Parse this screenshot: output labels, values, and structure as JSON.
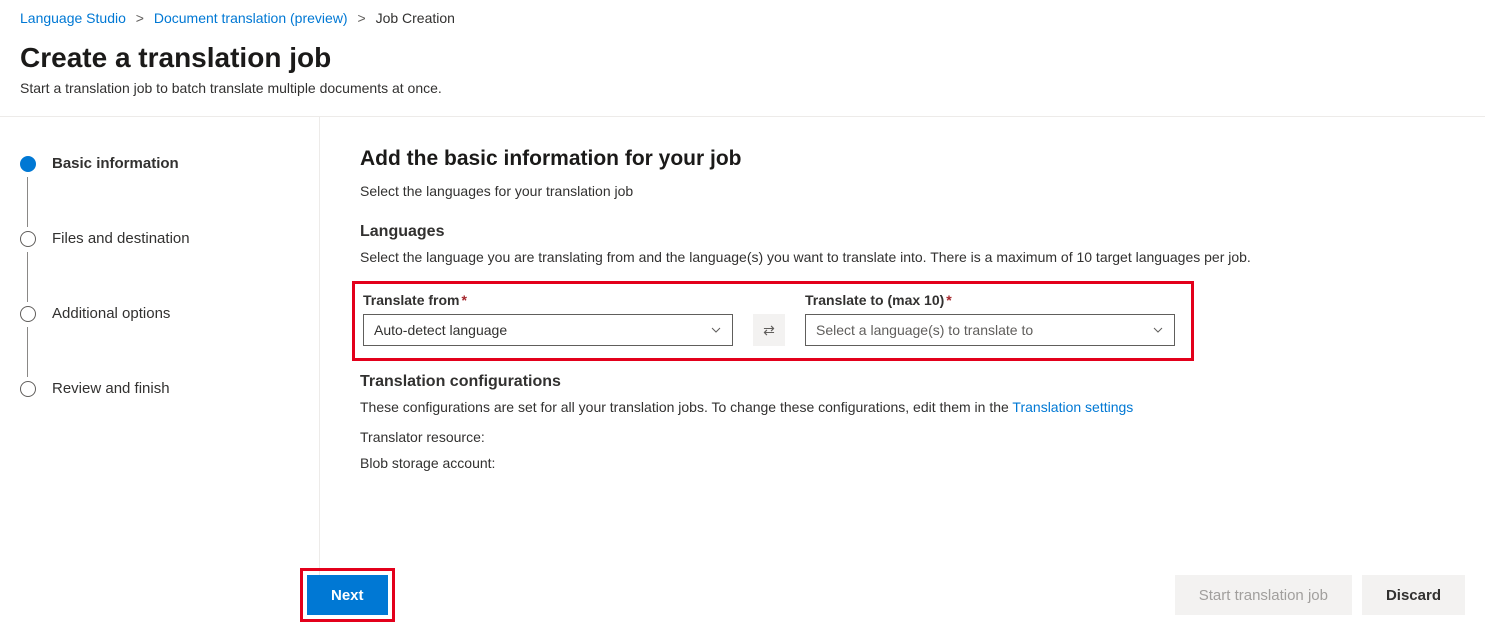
{
  "breadcrumb": {
    "items": [
      {
        "label": "Language Studio",
        "link": true
      },
      {
        "label": "Document translation (preview)",
        "link": true
      },
      {
        "label": "Job Creation",
        "link": false
      }
    ]
  },
  "header": {
    "title": "Create a translation job",
    "subtitle": "Start a translation job to batch translate multiple documents at once."
  },
  "steps": [
    {
      "label": "Basic information",
      "active": true
    },
    {
      "label": "Files and destination",
      "active": false
    },
    {
      "label": "Additional options",
      "active": false
    },
    {
      "label": "Review and finish",
      "active": false
    }
  ],
  "main": {
    "title": "Add the basic information for your job",
    "subtitle": "Select the languages for your translation job",
    "languages": {
      "heading": "Languages",
      "description": "Select the language you are translating from and the language(s) you want to translate into. There is a maximum of 10 target languages per job.",
      "from": {
        "label": "Translate from",
        "value": "Auto-detect language"
      },
      "to": {
        "label": "Translate to (max 10)",
        "placeholder": "Select a language(s) to translate to"
      }
    },
    "config": {
      "heading": "Translation configurations",
      "text_prefix": "These configurations are set for all your translation jobs. To change these configurations, edit them in the ",
      "link": "Translation settings",
      "translator_resource_label": "Translator resource:",
      "blob_storage_label": "Blob storage account:"
    }
  },
  "footer": {
    "next": "Next",
    "start": "Start translation job",
    "discard": "Discard"
  }
}
